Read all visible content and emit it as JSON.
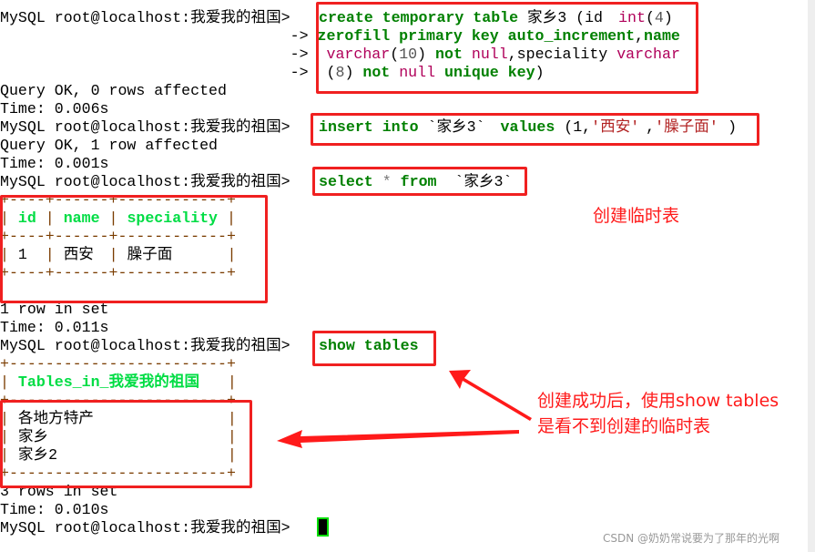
{
  "terminal": {
    "lines": [
      [
        [
          "MySQL root@localhost:我爱我的祖国> ",
          "p"
        ],
        [
          "create temporary table",
          "k"
        ],
        [
          " 家乡3 (id ",
          "p"
        ],
        [
          "int",
          "t"
        ],
        [
          "(",
          "p"
        ],
        [
          "4",
          "n"
        ],
        [
          ")",
          "p"
        ]
      ],
      [
        [
          "                                ",
          "p"
        ],
        [
          "-> ",
          "p"
        ],
        [
          "zerofill primary key auto_increment",
          "k"
        ],
        [
          ",",
          "p"
        ],
        [
          "name",
          "k"
        ]
      ],
      [
        [
          "                                ",
          "p"
        ],
        [
          "->  ",
          "p"
        ],
        [
          "varchar",
          "t"
        ],
        [
          "(",
          "p"
        ],
        [
          "10",
          "n"
        ],
        [
          ") ",
          "p"
        ],
        [
          "not",
          "k"
        ],
        [
          " ",
          "p"
        ],
        [
          "null",
          "t"
        ],
        [
          ",speciality ",
          "p"
        ],
        [
          "varchar",
          "t"
        ]
      ],
      [
        [
          "                                ",
          "p"
        ],
        [
          "->  ",
          "p"
        ],
        [
          "(",
          "p"
        ],
        [
          "8",
          "n"
        ],
        [
          ") ",
          "p"
        ],
        [
          "not",
          "k"
        ],
        [
          " ",
          "p"
        ],
        [
          "null",
          "t"
        ],
        [
          " ",
          "p"
        ],
        [
          "unique key",
          "k"
        ],
        [
          ")",
          "p"
        ]
      ],
      [
        [
          "Query OK, 0 rows affected",
          "p"
        ]
      ],
      [
        [
          "Time: 0.006s",
          "p"
        ]
      ],
      [
        [
          "MySQL root@localhost:我爱我的祖国> ",
          "p"
        ],
        [
          "insert into",
          "k"
        ],
        [
          " `家乡3` ",
          "p"
        ],
        [
          "values",
          "k"
        ],
        [
          " (1,",
          "p"
        ],
        [
          "'西安'",
          "s"
        ],
        [
          ",",
          "p"
        ],
        [
          "'臊子面'",
          "s"
        ],
        [
          ")",
          "p"
        ]
      ],
      [
        [
          "Query OK, 1 row affected",
          "p"
        ]
      ],
      [
        [
          "Time: 0.001s",
          "p"
        ]
      ],
      [
        [
          "MySQL root@localhost:我爱我的祖国> ",
          "p"
        ],
        [
          "select",
          "k"
        ],
        [
          " ",
          "p"
        ],
        [
          "*",
          "o"
        ],
        [
          " ",
          "p"
        ],
        [
          "from",
          "k"
        ],
        [
          "  `家乡3`",
          "p"
        ]
      ],
      [
        [
          "+----+------+------------+",
          "b"
        ]
      ],
      [
        [
          "| ",
          "b"
        ],
        [
          "id",
          "h"
        ],
        [
          " | ",
          "b"
        ],
        [
          "name",
          "h"
        ],
        [
          " | ",
          "b"
        ],
        [
          "speciality",
          "h"
        ],
        [
          " |",
          "b"
        ]
      ],
      [
        [
          "+----+------+------------+",
          "b"
        ]
      ],
      [
        [
          "| ",
          "b"
        ],
        [
          "1 ",
          "p"
        ],
        [
          " | ",
          "b"
        ],
        [
          "西安",
          "p"
        ],
        [
          " | ",
          "b"
        ],
        [
          "臊子面    ",
          "p"
        ],
        [
          " |",
          "b"
        ]
      ],
      [
        [
          "+----+------+------------+",
          "b"
        ]
      ],
      [
        [
          "",
          "p"
        ]
      ],
      [
        [
          "1 row in set",
          "p"
        ]
      ],
      [
        [
          "Time: 0.011s",
          "p"
        ]
      ],
      [
        [
          "MySQL root@localhost:我爱我的祖国> ",
          "p"
        ],
        [
          "show tables",
          "k"
        ]
      ],
      [
        [
          "+------------------------+",
          "b"
        ]
      ],
      [
        [
          "| ",
          "b"
        ],
        [
          "Tables_in_我爱我的祖国",
          "h"
        ],
        [
          " |",
          "b"
        ]
      ],
      [
        [
          "+------------------------+",
          "b"
        ]
      ],
      [
        [
          "| ",
          "b"
        ],
        [
          "各地方特产            ",
          "p"
        ],
        [
          " |",
          "b"
        ]
      ],
      [
        [
          "| ",
          "b"
        ],
        [
          "家乡                  ",
          "p"
        ],
        [
          " |",
          "b"
        ]
      ],
      [
        [
          "| ",
          "b"
        ],
        [
          "家乡2                 ",
          "p"
        ],
        [
          " |",
          "b"
        ]
      ],
      [
        [
          "+------------------------+",
          "b"
        ]
      ],
      [
        [
          "3 rows in set",
          "p"
        ]
      ],
      [
        [
          "Time: 0.010s",
          "p"
        ]
      ],
      [
        [
          "MySQL root@localhost:我爱我的祖国> ",
          "p"
        ]
      ]
    ]
  },
  "annotations": {
    "temp_table_note": "创建临时表",
    "show_tables_note_line1": "创建成功后，使用show tables",
    "show_tables_note_line2": "是看不到创建的临时表"
  },
  "watermark": "CSDN @奶奶常说要为了那年的光啊",
  "colors": {
    "annotation": "#ff1a1a",
    "keyword": "#008000",
    "header": "#00ee44",
    "border": "#7a3c00"
  }
}
